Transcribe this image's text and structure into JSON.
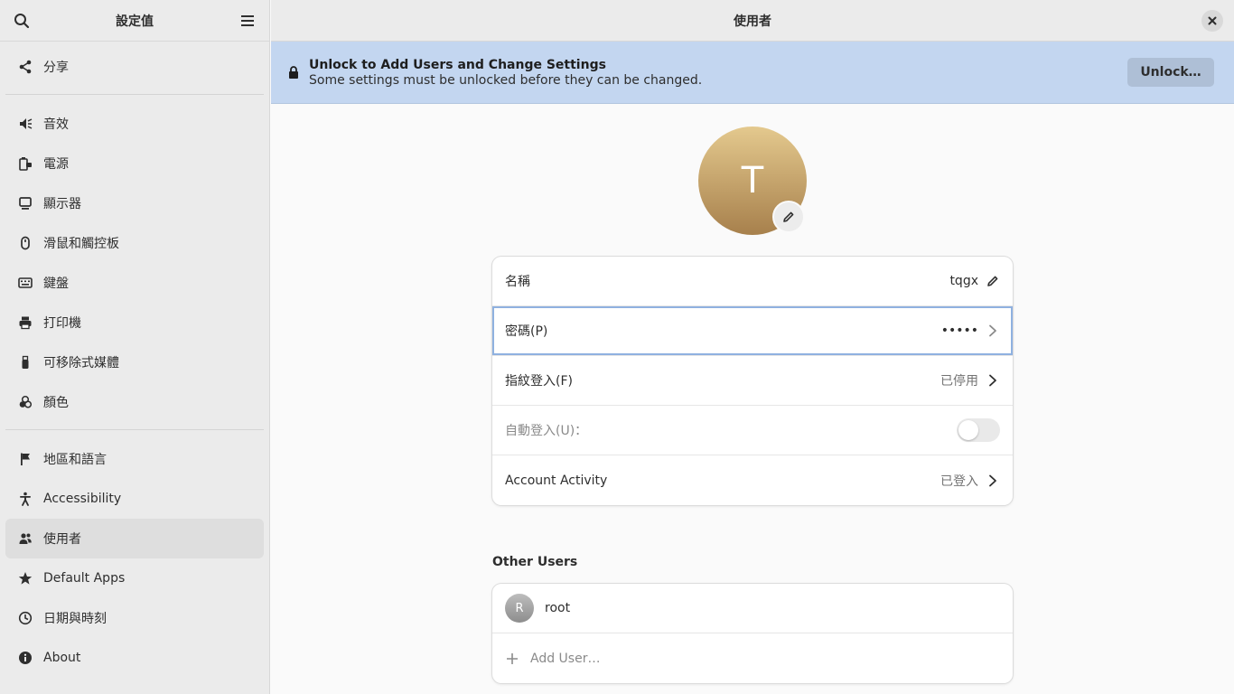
{
  "sidebar": {
    "title": "設定值",
    "search_icon": "search-icon",
    "menu_icon": "hamburger-menu-icon",
    "items": [
      {
        "label": "分享",
        "icon": "share-icon"
      },
      {
        "label": "音效",
        "icon": "speaker-icon"
      },
      {
        "label": "電源",
        "icon": "battery-plug-icon"
      },
      {
        "label": "顯示器",
        "icon": "display-icon"
      },
      {
        "label": "滑鼠和觸控板",
        "icon": "mouse-icon"
      },
      {
        "label": "鍵盤",
        "icon": "keyboard-icon"
      },
      {
        "label": "打印機",
        "icon": "printer-icon"
      },
      {
        "label": "可移除式媒體",
        "icon": "usb-drive-icon"
      },
      {
        "label": "顏色",
        "icon": "color-icon"
      },
      {
        "label": "地區和語言",
        "icon": "flag-icon"
      },
      {
        "label": "Accessibility",
        "icon": "accessibility-icon"
      },
      {
        "label": "使用者",
        "icon": "users-icon",
        "active": true
      },
      {
        "label": "Default Apps",
        "icon": "star-icon"
      },
      {
        "label": "日期與時刻",
        "icon": "clock-icon"
      },
      {
        "label": "About",
        "icon": "info-icon"
      }
    ]
  },
  "main": {
    "title": "使用者",
    "banner": {
      "title": "Unlock to Add Users and Change Settings",
      "subtitle": "Some settings must be unlocked before they can be changed.",
      "button": "Unlock…"
    },
    "avatar_letter": "T",
    "account_rows": [
      {
        "label": "名稱",
        "value": "tqgx"
      },
      {
        "label": "密碼(P)",
        "value": "•••••"
      },
      {
        "label": "指紋登入(F)",
        "value": "已停用"
      },
      {
        "label": "自動登入(U)：",
        "toggle": false
      },
      {
        "label": "Account Activity",
        "value": "已登入"
      }
    ],
    "other_users_title": "Other Users",
    "other_users": [
      {
        "initial": "R",
        "name": "root"
      }
    ],
    "add_user_label": "Add User…"
  },
  "colors": {
    "accent_banner": "#c3d6f0",
    "avatar_gold": "#c9a46a",
    "focus_ring": "#8fb1e0"
  }
}
